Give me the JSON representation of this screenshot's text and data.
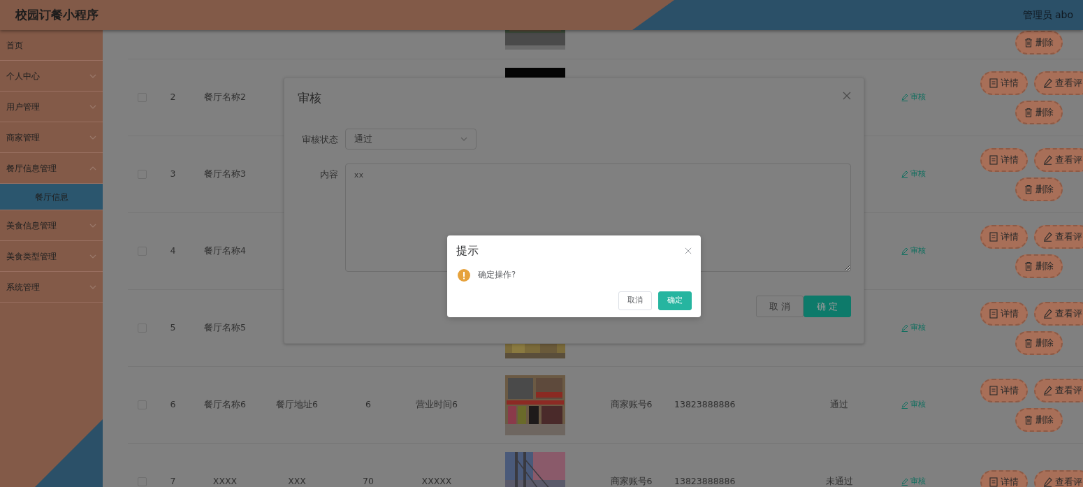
{
  "header": {
    "title": "校园订餐小程序",
    "user": "管理员 abo"
  },
  "sidebar": {
    "items": [
      {
        "label": "首页",
        "expandable": false
      },
      {
        "label": "个人中心",
        "expandable": true,
        "expanded": false
      },
      {
        "label": "用户管理",
        "expandable": true,
        "expanded": false
      },
      {
        "label": "商家管理",
        "expandable": true,
        "expanded": false
      },
      {
        "label": "餐厅信息管理",
        "expandable": true,
        "expanded": true,
        "children": [
          {
            "label": "餐厅信息",
            "selected": true
          }
        ]
      },
      {
        "label": "美食信息管理",
        "expandable": true,
        "expanded": false
      },
      {
        "label": "美食类型管理",
        "expandable": true,
        "expanded": false
      },
      {
        "label": "系统管理",
        "expandable": true,
        "expanded": false
      }
    ]
  },
  "table": {
    "rows": [
      {
        "kind": "cut",
        "picture": {
          "kind": "picture"
        },
        "actions": [
          {
            "kind": "delete",
            "label": "删除"
          }
        ]
      },
      {
        "kind": "full",
        "checked": false,
        "index": "2",
        "name": "餐厅名称2",
        "picture": {
          "kind": "picture"
        },
        "review": "审核",
        "actions": [
          {
            "kind": "detail",
            "label": "详情"
          },
          {
            "kind": "comments",
            "label": "查看评"
          },
          {
            "kind": "delete",
            "label": "删除"
          }
        ]
      },
      {
        "kind": "full",
        "checked": false,
        "index": "3",
        "name": "餐厅名称3",
        "review": "审核",
        "actions": [
          {
            "kind": "detail",
            "label": "详情"
          },
          {
            "kind": "comments",
            "label": "查看评"
          },
          {
            "kind": "delete",
            "label": "删除"
          }
        ]
      },
      {
        "kind": "full",
        "checked": false,
        "index": "4",
        "name": "餐厅名称4",
        "review": "审核",
        "actions": [
          {
            "kind": "detail",
            "label": "详情"
          },
          {
            "kind": "comments",
            "label": "查看评"
          },
          {
            "kind": "delete",
            "label": "删除"
          }
        ]
      },
      {
        "kind": "full",
        "checked": false,
        "index": "5",
        "name": "餐厅名称5",
        "picture": {
          "kind": "picture"
        },
        "review": "审核",
        "actions": [
          {
            "kind": "detail",
            "label": "详情"
          },
          {
            "kind": "comments",
            "label": "查看评"
          },
          {
            "kind": "delete",
            "label": "删除"
          }
        ]
      },
      {
        "kind": "full",
        "checked": false,
        "index": "6",
        "name": "餐厅名称6",
        "address": "餐厅地址6",
        "count": "6",
        "hours": "营业时间6",
        "picture": {
          "kind": "picture"
        },
        "merchant": "商家账号6",
        "phone": "13823888886",
        "status": "通过",
        "review": "审核",
        "actions": [
          {
            "kind": "detail",
            "label": "详情"
          },
          {
            "kind": "comments",
            "label": "查看评"
          },
          {
            "kind": "delete",
            "label": "删除"
          }
        ]
      },
      {
        "kind": "full",
        "checked": false,
        "index": "7",
        "name": "XXXX",
        "address": "XXX",
        "count": "70",
        "hours": "XXXXX",
        "picture": {
          "kind": "picture"
        },
        "merchant": "商家账号6",
        "phone": "13823888886",
        "status": "未通过",
        "review": "审核",
        "actions": [
          {
            "kind": "detail",
            "label": "详情"
          },
          {
            "kind": "comments",
            "label": "查看评"
          }
        ]
      }
    ]
  },
  "audit_dialog": {
    "title": "审核",
    "fields": [
      {
        "kind": "select",
        "label": "审核状态",
        "value": "通过"
      },
      {
        "kind": "textarea",
        "label": "内容",
        "value": "xx"
      }
    ],
    "buttons": [
      {
        "kind": "default",
        "label": "取 消"
      },
      {
        "kind": "primary",
        "label": "确 定"
      }
    ]
  },
  "message_box": {
    "title": "提示",
    "message": "确定操作?",
    "buttons": [
      {
        "kind": "default",
        "label": "取消"
      },
      {
        "kind": "primary",
        "label": "确定"
      }
    ]
  }
}
